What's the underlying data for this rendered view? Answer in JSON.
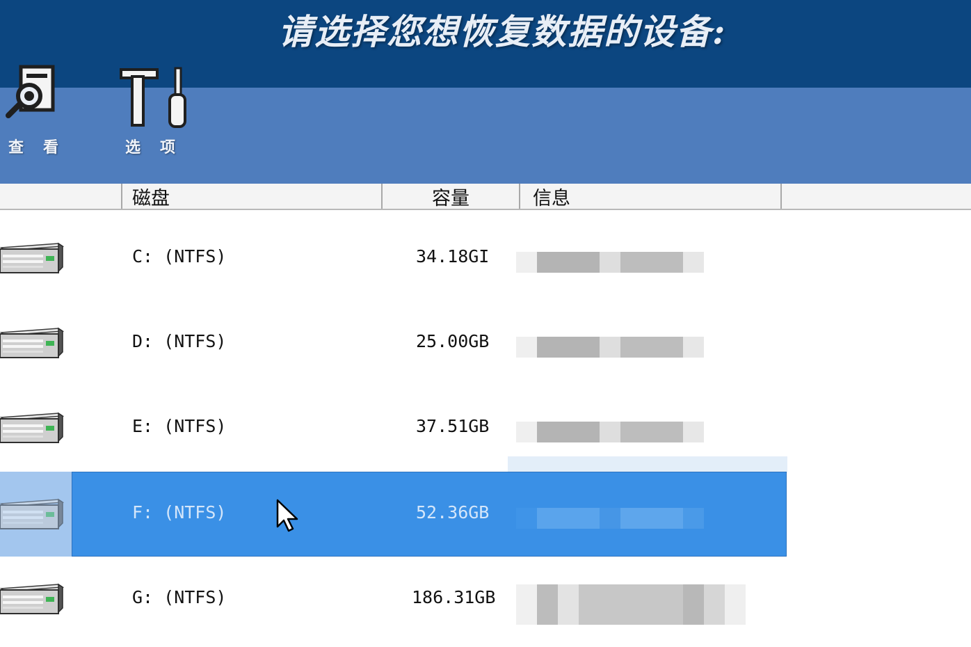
{
  "title": "请选择您想恢复数据的设备:",
  "toolbar": {
    "view_label": "查看",
    "options_label": "选项"
  },
  "columns": {
    "disk": "磁盘",
    "capacity": "容量",
    "info": "信息"
  },
  "drives": [
    {
      "name": "C: (NTFS)",
      "capacity": "34.18GI"
    },
    {
      "name": "D: (NTFS)",
      "capacity": "25.00GB"
    },
    {
      "name": "E: (NTFS)",
      "capacity": "37.51GB"
    },
    {
      "name": "F: (NTFS)",
      "capacity": "52.36GB"
    },
    {
      "name": "G: (NTFS)",
      "capacity": "186.31GB"
    }
  ],
  "selected_drive": "F: (NTFS)",
  "colors": {
    "title_bar": "#0c4680",
    "toolbar": "#4f7dbd",
    "selection": "#3a90e6"
  },
  "icons": {
    "view": "magnifier-document-icon",
    "options": "hammer-screwdriver-icon",
    "drive": "hard-drive-icon",
    "pointer": "mouse-pointer-icon"
  }
}
